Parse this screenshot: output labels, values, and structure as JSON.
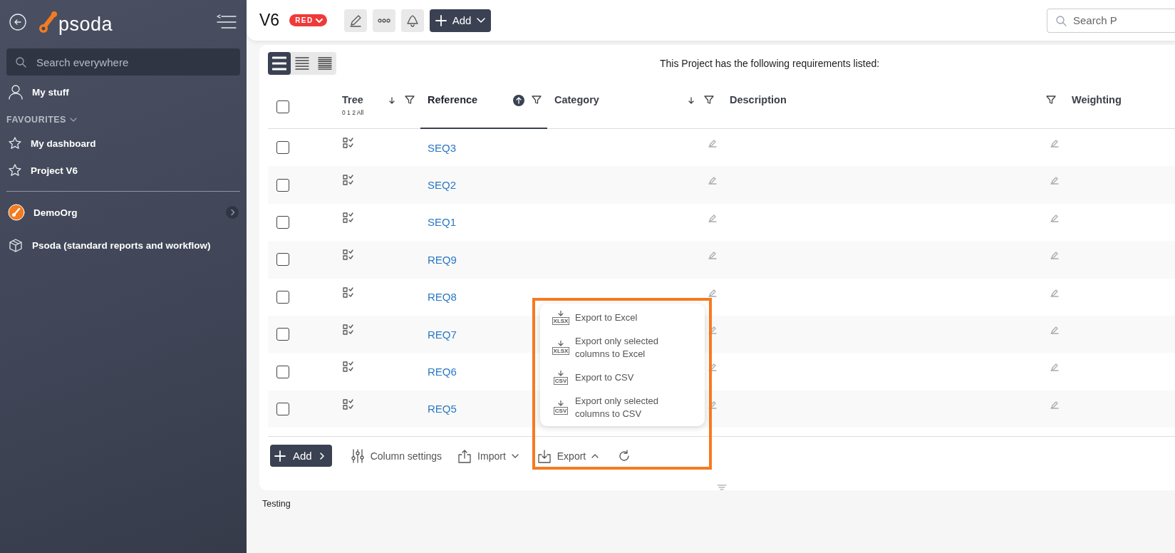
{
  "sidebar": {
    "logo": "psoda",
    "search": {
      "placeholder": "Search everywhere"
    },
    "my_stuff": "My stuff",
    "favourites": {
      "label": "FAVOURITES",
      "expanded": true,
      "items": [
        {
          "label": "My dashboard"
        },
        {
          "label": "Project V6"
        }
      ]
    },
    "orgs": [
      {
        "kind": "org",
        "label": "DemoOrg"
      },
      {
        "kind": "package",
        "label": "Psoda (standard reports and workflow)"
      }
    ]
  },
  "header": {
    "title": "V6",
    "status": {
      "label": "RED",
      "color": "#f03a3a"
    },
    "add_button": "Add",
    "search": {
      "placeholder": "Search P"
    }
  },
  "view_modes": [
    {
      "selected": true
    },
    {
      "selected": false
    },
    {
      "selected": false
    }
  ],
  "caption": "This Project has the following requirements listed:",
  "table": {
    "select_all_checked": false,
    "columns": [
      {
        "label": "Tree",
        "sub": "0 1 2 All",
        "sort_arrow": true,
        "ascending": false,
        "sort_active": false,
        "filter": true
      },
      {
        "label": "Reference",
        "sort_arrow": true,
        "ascending": true,
        "sort_active": true,
        "filter": true
      },
      {
        "label": "Category",
        "sort_arrow": true,
        "ascending": false,
        "sort_active": false,
        "filter": true
      },
      {
        "label": "Description",
        "sort_arrow": false,
        "sort_active": false,
        "filter": true
      },
      {
        "label": "Weighting",
        "sort_arrow": false,
        "sort_active": false,
        "filter": false
      }
    ],
    "rows": [
      {
        "reference": "SEQ3",
        "checked": false
      },
      {
        "reference": "SEQ2",
        "checked": false
      },
      {
        "reference": "SEQ1",
        "checked": false
      },
      {
        "reference": "REQ9",
        "checked": false
      },
      {
        "reference": "REQ8",
        "checked": false
      },
      {
        "reference": "REQ7",
        "checked": false
      },
      {
        "reference": "REQ6",
        "checked": false
      },
      {
        "reference": "REQ5",
        "checked": false
      }
    ]
  },
  "footer": {
    "add": "Add",
    "column_settings": "Column settings",
    "import": "Import",
    "export": {
      "label": "Export",
      "expanded": true
    }
  },
  "export_menu": [
    {
      "label": "Export to Excel",
      "format": "XLSX"
    },
    {
      "label": "Export only selected columns to Excel",
      "format": "XLSX"
    },
    {
      "label": "Export to CSV",
      "format": "CSV"
    },
    {
      "label": "Export only selected columns to CSV",
      "format": "CSV"
    }
  ],
  "page_footer": "Testing"
}
